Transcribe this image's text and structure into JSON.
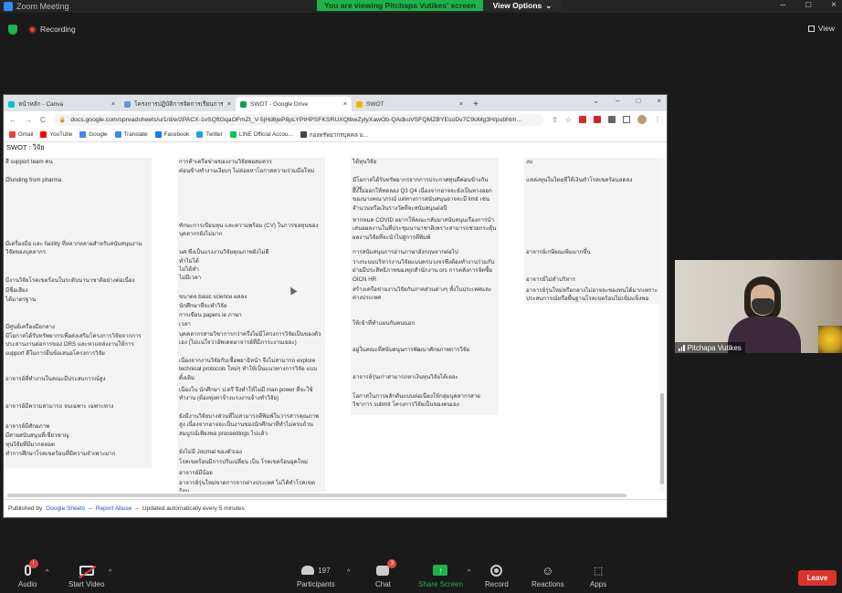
{
  "zoom": {
    "window_title": "Zoom Meeting",
    "viewing_message": "You are viewing Pitchapa Vutikes' screen",
    "view_options": "View Options",
    "view_options_caret": "⌄",
    "recording_label": "Recording",
    "view_label": "View",
    "window_controls": {
      "minimize": "–",
      "maximize": "□",
      "close": "×"
    }
  },
  "browser": {
    "tabs": [
      {
        "label": "หน้าหลัก - Canva",
        "color": "#00c4cc",
        "active": false
      },
      {
        "label": "โครงการปฏิบัติการจัดการเรียนการสอน",
        "color": "#6a8fd6",
        "active": false
      },
      {
        "label": "SWOT - Google Drive",
        "color": "#0f9d58",
        "active": true
      },
      {
        "label": "SWOT",
        "color": "#f4b400",
        "active": false
      }
    ],
    "tab_close": "×",
    "new_tab": "+",
    "tab_controls": {
      "down": "⌄",
      "minimize": "–",
      "restore": "□",
      "close": "×"
    },
    "nav": {
      "back": "←",
      "forward": "→",
      "reload": "C"
    },
    "url": "docs.google.com/spreadsheets/u/1/d/e/2PACX-1vSQftGqaOFmZt_V-5jHd6jeP8pLYPtHPSFKSRUXQlbwZylyXawOb-QAdkuVSFQMZBYEsoDv7C9oMg3H/pubhtm...",
    "omnibox_icons": {
      "lock": "🔒",
      "share": "⇧",
      "star": "☆"
    },
    "bookmarks": [
      {
        "label": "Gmail",
        "color": "#ea4335"
      },
      {
        "label": "YouTube",
        "color": "#ff0000"
      },
      {
        "label": "Google",
        "color": "#4285f4"
      },
      {
        "label": "Translate",
        "color": "#4285f4"
      },
      {
        "label": "Facebook",
        "color": "#1877f2"
      },
      {
        "label": "Twitter",
        "color": "#1da1f2"
      },
      {
        "label": "LINE Official Accou...",
        "color": "#06c755"
      },
      {
        "label": "กองทรัพยากรบุคคล ม...",
        "color": "#444444"
      }
    ],
    "more_icon": "⋮"
  },
  "sheet": {
    "title": "SWOT : วิจัย",
    "col1": [
      "สี support team คน",
      "มีfunding from pharma",
      "มีเครื่องมือ และ facility ที่หลากหลายสำหรับสนับสนุนงานวิจัยของบุคลากร",
      "มีงานวิจัยโรคเขตร้อนในระดับนานาชาติอย่างต่อเนื่อง",
      "มีชื่อเสียง",
      "ได้มาตรฐาน",
      "มีศูนย์เครื่องมือกลาง",
      "มีโอกาสได้รับทรัพยากรเพื่อส่งเสริมโครงการวิจัยจากการประสานงานต่อการของ ORS และหาแหล่งงานให้การ support ดีในการยื่นข้อเสนอโครงการวิจัย",
      "อาจารย์ที่ทำงานในคณะมีประสบการณ์สูง",
      "อาจารย์มีความสามารถ จบเฉพาะ เฉพาะทาง",
      "อาจารย์มีศักยภาพ",
      "มีสายสนับสนุนที่เชี่ยวชาญ",
      "ทุนวิจัยที่มีมากตลอด",
      "ทำการศึกษาโรคเขตร้อนที่มีความจำเพาะมาก"
    ],
    "col2": [
      "การค้าเครือข่ายของงานวิจัยพอสมควร",
      "ค่อนข้างทำงานเงียบๆ ไม่ค่อยหาโอกาสความร่วมมือใหม่",
      "ทักษะการเขียนทุน และความพร้อม (CV) ในการขอทุนของบุคลากรยังไม่มาก",
      "นศ.ซึ่งเป็นแรงงานวิจัยคุณภาพยังไม่ดี",
      "ทำไม่ได้",
      "ไม่ได้ทำ",
      "ไม่มีเวลา",
      "ขนาดจ basic science ผลลง",
      "นักศึกษาที่จะทำวิจัย",
      "การเขียน papers ie ภาษา",
      "เวลา",
      "บุคคลากรสายวิชาการกว่าครึ่งไม่มีโครงการวิจัยเป็นของตัวเอง (ไม่แน่ใจว่าอัพเดตอาจารย์ที่มีภาระงานเยอะ)",
      "เนื่องจากงานวิจัยกับเชื้อพยาธิหน้า จึงไม่สามารถ explore technical protocols ใหม่ๆ ทำให้เป็นแนวทางการวิจัย แบบดั้งเดิม",
      "เนื่องใน นักศึกษา ป.ตรี จึงทำให้ไม่มี man power ที่จะใช้ทำงาน (ต้องทุ่งค่าจ้างแรงงานจ้างทำวิจัย)",
      "ยังมีงานวิจัยบางส่วนที่ไม่สามารถตีพิมพ์ในวารสารคุณภาพสูง เนื่องจากอาจจะเป็นงานของนักศึกษาที่ทำไม่ครบถ้วนสมบูรณ์เพียงพอ proceedings ไปแล้ว",
      "ยังไม่มี Journal ของตัวเอง",
      "โรคเขตร้อนมีการปรับเปลี่ยน เป็น โรคเขตร้อนยุคใหม่",
      "อาจารย์มีน้อย",
      "อาจารย์รุ่นใหม่ขาดการจากต่างประเทศ ไม่ได้ทำโรคเขตร้อน"
    ],
    "col3": [
      "ได้ทุนวิจัย",
      "มีโอกาสได้รับทรัพยากรจากการประกาศทุนที่ค่อนข้างกันการ",
      "ยังไม่ออกให้ทดลอง Q3 Q4 เนื่องจากอาจจะยังเป็นทางออกของนางคณาภรณ์ แต่ทางการสนับสนุนอาจจะมี limit เช่น จำนวนหรือเงินรางวัลที่จะสนับสนุนต่อปี",
      "หากหมด COVID อยากให้คณะกลับมาสนับสนุนเรื่องการนำเสนอผลงานในที่ประชุมนานาชาติเพราะสามารถช่วยกระตุ้นผลงานวิจัยที่จะนำไปสู่การตีพิมพ์",
      "การสนับสนุนการอ่านภาษาอังกฤษจากต่อไป",
      "วางระบบบริหารงานวิจัยแบบครบวงจรซึ่งต้องทำงานร่วมกับฝ่ายมีประสิทธิภาพของทุกสำนักงาน ors การคลังการจัดซื้อ OICN HR",
      "สร้างเครือข่ายงานวิจัยกับภาคส่วนต่างๆ ทั้งในประเทศและต่างประเทศ",
      "ให้เข้าที่ทำแผนกับคนนอก",
      "อยู่ในคณะที่สนับสนุนการพัฒนาศักยภาพการวิจัย",
      "อาจารย์รุ่นเก่าสามารถหาเงินทุนวิจัยได้เยอะ",
      "โอกาสในการผลักดันแบบต่อเนื่องให้กลุ่มบุคลากรสายวิชาการ submit โครงการวิจัยเป็นของตนเอง"
    ],
    "col4": [
      "งบ",
      "แหล่งทุนในไทยที่ให้เงินทำโรคเขตร้อนลดลง",
      "อาจารย์เกษียณเพิ่มมากขึ้น",
      "อาจารย์ไม่ทำบริหาร",
      "อาจารย์รุ่นใหม่หรือกลางไม่อาจจะของทนได้มากเพราะประสบการณ์หรือพื้นฐานโรคเขตร้อนไม่เข้มแข็งพอ"
    ],
    "published_by": "Published by",
    "google_sheets": "Google Sheets",
    "dash": "–",
    "report_abuse": "Report Abuse",
    "updated": "Updated automatically every 5 minutes"
  },
  "participant": {
    "name": "Pitchapa Vutikes"
  },
  "toolbar": {
    "audio": "Audio",
    "mic_badge": "!",
    "video": "Start Video",
    "participants": "Participants",
    "participants_count": "197",
    "chat": "Chat",
    "chat_badge": "3",
    "share": "Share Screen",
    "share_arrow": "↑",
    "record": "Record",
    "reactions": "Reactions",
    "reactions_icon": "☺",
    "apps": "Apps",
    "apps_icon": "⬚",
    "caret": "^",
    "leave": "Leave"
  }
}
